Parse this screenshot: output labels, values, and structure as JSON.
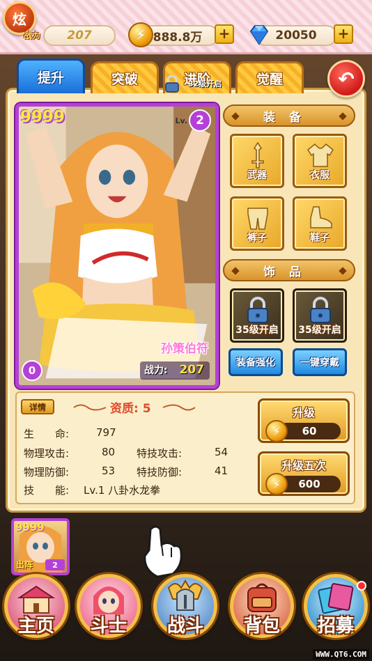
{
  "topbar": {
    "logo_text": "炫",
    "power_tag": "战力",
    "power_value": "207",
    "gold_value": "888.8万",
    "gem_value": "20050",
    "plus": "+"
  },
  "tabs": [
    {
      "label": "提升",
      "active": true
    },
    {
      "label": "突破",
      "active": false
    },
    {
      "label": "进阶",
      "active": false,
      "lock_label": "32级开启"
    },
    {
      "label": "觉醒",
      "active": false
    }
  ],
  "card": {
    "stars": "9999",
    "lv_label": "Lv.",
    "level": "2",
    "name": "孙策伯符",
    "power_label": "战力:",
    "power_value": "207",
    "count": "0"
  },
  "equipment": {
    "title": "装备",
    "slots": [
      {
        "label": "武器",
        "icon": "sword-icon"
      },
      {
        "label": "衣服",
        "icon": "shirt-icon"
      },
      {
        "label": "裤子",
        "icon": "pants-icon"
      },
      {
        "label": "鞋子",
        "icon": "shoe-icon"
      }
    ]
  },
  "accessories": {
    "title": "饰品",
    "slots": [
      {
        "label": "35级开启",
        "icon": "lock-icon"
      },
      {
        "label": "35级开启",
        "icon": "lock-icon"
      }
    ]
  },
  "actions": {
    "enhance_label": "装备强化",
    "equip_all_label": "一键穿戴"
  },
  "stats": {
    "detail_label": "详情",
    "quality": "资质: 5",
    "rows": [
      {
        "label": "生　　命:",
        "value": "797"
      },
      {
        "label": "物理攻击:",
        "value": "80",
        "label2": "特技攻击:",
        "value2": "54"
      },
      {
        "label": "物理防御:",
        "value": "53",
        "label2": "特技防御:",
        "value2": "41"
      },
      {
        "label": "技　　能:",
        "value": "Lv.1 八卦水龙拳"
      }
    ]
  },
  "levelup": {
    "single_label": "升级",
    "single_cost": "60",
    "five_label": "升级五次",
    "five_cost": "600"
  },
  "team": {
    "stars": "9999",
    "deploy_label": "出阵",
    "count": "2"
  },
  "nav": [
    {
      "label": "主页",
      "icon": "house-icon"
    },
    {
      "label": "斗士",
      "icon": "fighter-icon"
    },
    {
      "label": "战斗",
      "icon": "battle-helmet-icon"
    },
    {
      "label": "背包",
      "icon": "backpack-icon"
    },
    {
      "label": "招募",
      "icon": "recruit-cards-icon",
      "badge": true
    }
  ],
  "watermark": "WWW.QT6.COM",
  "colors": {
    "card_border": "#b540d8",
    "tab_active": "#1a6fd8",
    "gold_button": "#e29a20",
    "blue_button": "#1f8ae0",
    "quality_text": "#e04a2a"
  }
}
